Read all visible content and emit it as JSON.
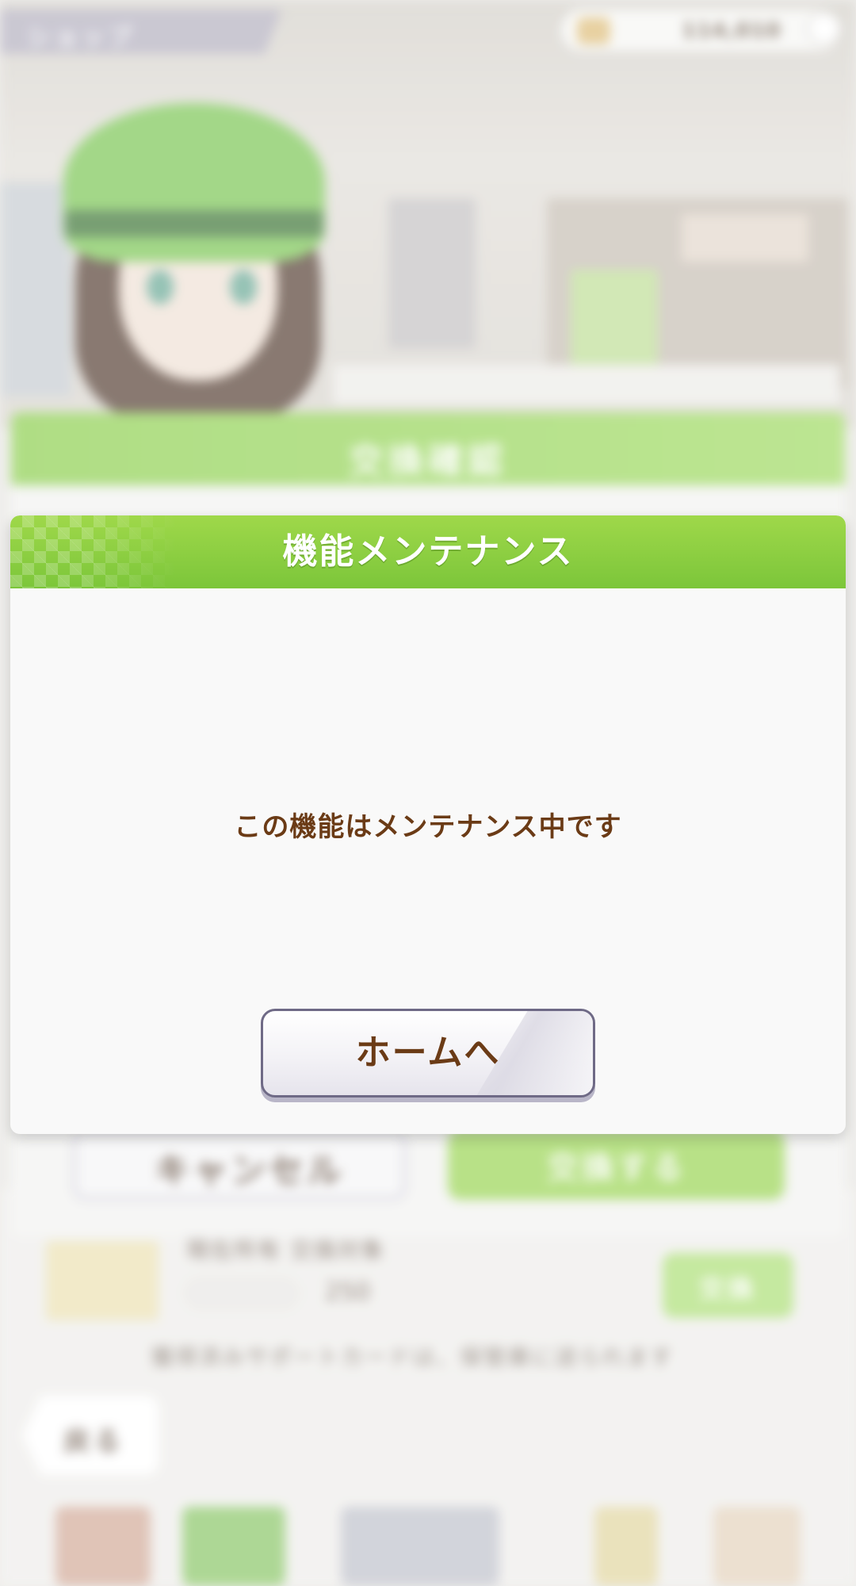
{
  "background": {
    "top_tab_label": "ショップ",
    "coin_balance": "114,010",
    "underlying_dialog": {
      "title": "交換確認",
      "cancel_label": "キャンセル",
      "confirm_label": "交換する"
    },
    "item": {
      "name": "現在所有 交換対象",
      "price": "250",
      "exchange_label": "交換"
    },
    "note": "獲得済みサポートカードは、保管庫に送られます",
    "back_label": "戻る"
  },
  "modal": {
    "title": "機能メンテナンス",
    "message": "この機能はメンテナンス中です",
    "home_button_label": "ホームへ"
  },
  "colors": {
    "header_green": "#8ccf42",
    "text_brown": "#6b3b16",
    "button_border": "#6f6a86"
  }
}
